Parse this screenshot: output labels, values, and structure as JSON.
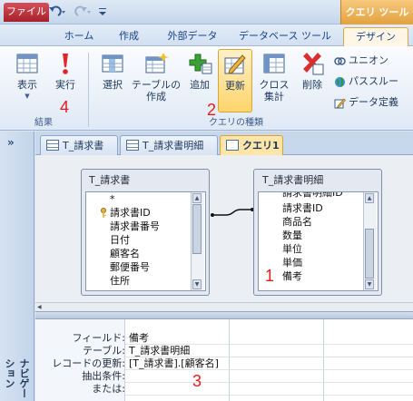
{
  "app_icon": "A",
  "context_tab_title": "クエリ ツール",
  "ribbon_tabs": [
    "ファイル",
    "ホーム",
    "作成",
    "外部データ",
    "データベース ツール",
    "デザイン"
  ],
  "ribbon": {
    "view_label": "表示",
    "run_label": "実行",
    "results_group": "結果",
    "select_label": "選択",
    "make_table_label_1": "テーブルの",
    "make_table_label_2": "作成",
    "append_label": "追加",
    "update_label": "更新",
    "crosstab_label_1": "クロス",
    "crosstab_label_2": "集計",
    "delete_label": "削除",
    "query_type_group": "クエリの種類",
    "union_label": "ユニオン",
    "passthrough_label": "パススルー",
    "data_definition_label": "データ定義"
  },
  "annotations": {
    "n1": "1",
    "n2": "2",
    "n3": "3",
    "n4": "4"
  },
  "nav_toggle": "»",
  "nav_label": "ナビゲーション ウィンドウ",
  "object_tabs": [
    "T_請求書",
    "T_請求書明細",
    "クエリ1"
  ],
  "tables": [
    {
      "title": "T_請求書",
      "fields": [
        "*",
        "請求書ID",
        "請求書番号",
        "日付",
        "顧客名",
        "郵便番号",
        "住所"
      ]
    },
    {
      "title": "T_請求書明細",
      "fields": [
        "請求書明細ID",
        "請求書ID",
        "商品名",
        "数量",
        "単位",
        "単価",
        "備考"
      ]
    }
  ],
  "grid": {
    "row_labels": [
      "フィールド:",
      "テーブル:",
      "レコードの更新:",
      "抽出条件:",
      "または:"
    ],
    "column1": [
      "備考",
      "T_請求書明細",
      "[T_請求書].[顧客名]",
      "",
      ""
    ]
  },
  "colors": {
    "accent_red": "#e21c1c",
    "context_orange": "#e4a13d",
    "file_tab": "#b3262f"
  }
}
